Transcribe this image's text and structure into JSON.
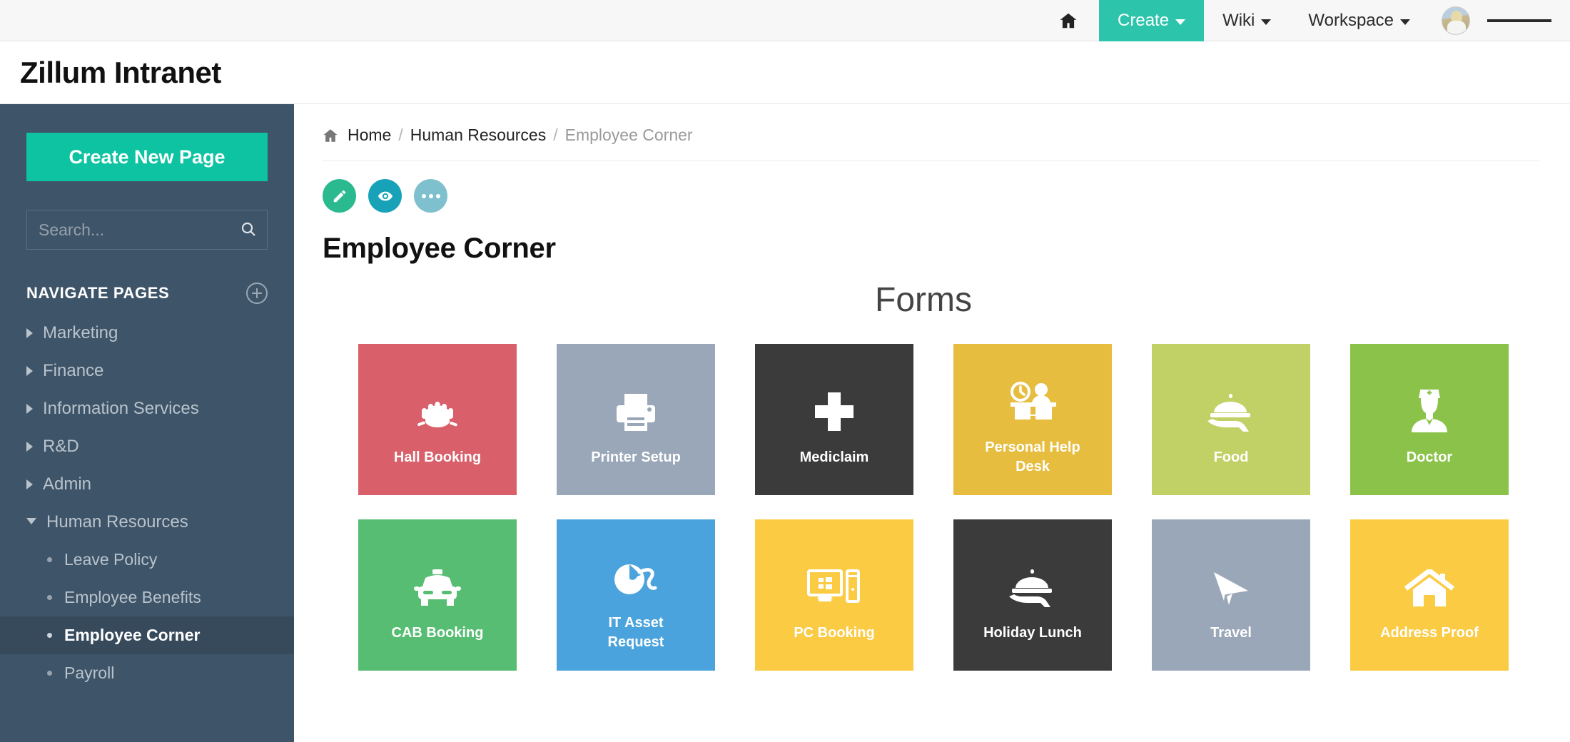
{
  "topnav": {
    "home_icon": "home-icon",
    "items": [
      {
        "label": "Create",
        "icon": "chevron-down-icon",
        "active": true
      },
      {
        "label": "Wiki",
        "icon": "chevron-down-icon",
        "active": false
      },
      {
        "label": "Workspace",
        "icon": "chevron-down-icon",
        "active": false
      }
    ],
    "avatar_alt": "user-avatar",
    "menu_icon": "hamburger-menu-icon",
    "accent_color": "#2cc5ac"
  },
  "header": {
    "app_title": "Zillum Intranet"
  },
  "sidebar": {
    "create_button": "Create New Page",
    "search": {
      "value": "",
      "placeholder": "Search...",
      "icon": "search-icon"
    },
    "section_label": "NAVIGATE PAGES",
    "add_icon": "plus-circle-icon",
    "background_color": "#3e5468",
    "create_button_color": "#0dc3a2",
    "items": [
      {
        "label": "Marketing",
        "expanded": false
      },
      {
        "label": "Finance",
        "expanded": false
      },
      {
        "label": "Information Services",
        "expanded": false
      },
      {
        "label": "R&D",
        "expanded": false
      },
      {
        "label": "Admin",
        "expanded": false
      },
      {
        "label": "Human Resources",
        "expanded": true
      }
    ],
    "sub_items": [
      {
        "label": "Leave Policy",
        "active": false
      },
      {
        "label": "Employee Benefits",
        "active": false
      },
      {
        "label": "Employee Corner",
        "active": true
      },
      {
        "label": "Payroll",
        "active": false
      }
    ]
  },
  "main": {
    "breadcrumb": {
      "home_icon": "home-icon",
      "home": "Home",
      "sep": "/",
      "parent": "Human Resources",
      "current": "Employee Corner"
    },
    "actions": [
      {
        "name": "edit-button",
        "icon": "pencil-icon",
        "color": "#2bb98f"
      },
      {
        "name": "view-button",
        "icon": "eye-icon",
        "color": "#18a2b8"
      },
      {
        "name": "more-button",
        "icon": "ellipsis-icon",
        "color": "#7ec0cd"
      }
    ],
    "page_title": "Employee Corner",
    "forms_heading": "Forms",
    "tiles_row1": [
      {
        "label": "Hall Booking",
        "icon": "conference-table-icon",
        "color": "#d9606a"
      },
      {
        "label": "Printer Setup",
        "icon": "printer-icon",
        "color": "#9aa7b8"
      },
      {
        "label": "Mediclaim",
        "icon": "medical-cross-icon",
        "color": "#3b3b3b"
      },
      {
        "label": "Personal Help Desk",
        "icon": "help-desk-icon",
        "color": "#e6bd3f"
      },
      {
        "label": "Food",
        "icon": "food-tray-icon",
        "color": "#c2d166"
      },
      {
        "label": "Doctor",
        "icon": "doctor-icon",
        "color": "#8bc34a"
      }
    ],
    "tiles_row2": [
      {
        "label": "CAB Booking",
        "icon": "taxi-icon",
        "color": "#56bd72"
      },
      {
        "label": "IT Asset Request",
        "icon": "computer-mouse-icon",
        "color": "#4aa3dc"
      },
      {
        "label": "PC Booking",
        "icon": "desktop-pc-icon",
        "color": "#fbcb44"
      },
      {
        "label": "Holiday Lunch",
        "icon": "food-tray-icon",
        "color": "#3b3b3b"
      },
      {
        "label": "Travel",
        "icon": "paper-plane-icon",
        "color": "#9aa7b8"
      },
      {
        "label": "Address Proof",
        "icon": "house-icon",
        "color": "#fbcb44"
      }
    ]
  }
}
